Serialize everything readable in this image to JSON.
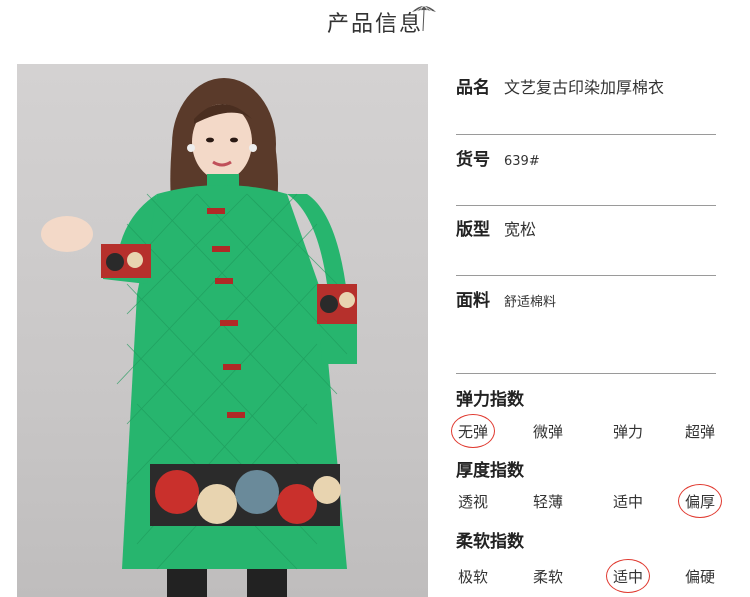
{
  "header": {
    "title": "产品信息",
    "icon": "lotus-leaf-icon"
  },
  "details": {
    "name_label": "品名",
    "name_value": "文艺复古印染加厚棉衣",
    "sku_label": "货号",
    "sku_value": "639#",
    "fit_label": "版型",
    "fit_value": "宽松",
    "fabric_label": "面料",
    "fabric_value": "舒适棉料"
  },
  "indices": [
    {
      "title": "弹力指数",
      "options": [
        "无弹",
        "微弹",
        "弹力",
        "超弹"
      ],
      "selected": 0
    },
    {
      "title": "厚度指数",
      "options": [
        "透视",
        "轻薄",
        "适中",
        "偏厚"
      ],
      "selected": 3
    },
    {
      "title": "柔软指数",
      "options": [
        "极软",
        "柔软",
        "适中",
        "偏硬"
      ],
      "selected": 2
    }
  ],
  "colors": {
    "coat": "#27b56e",
    "highlight_circle": "#e0392f",
    "rule": "#9a9a9a"
  }
}
